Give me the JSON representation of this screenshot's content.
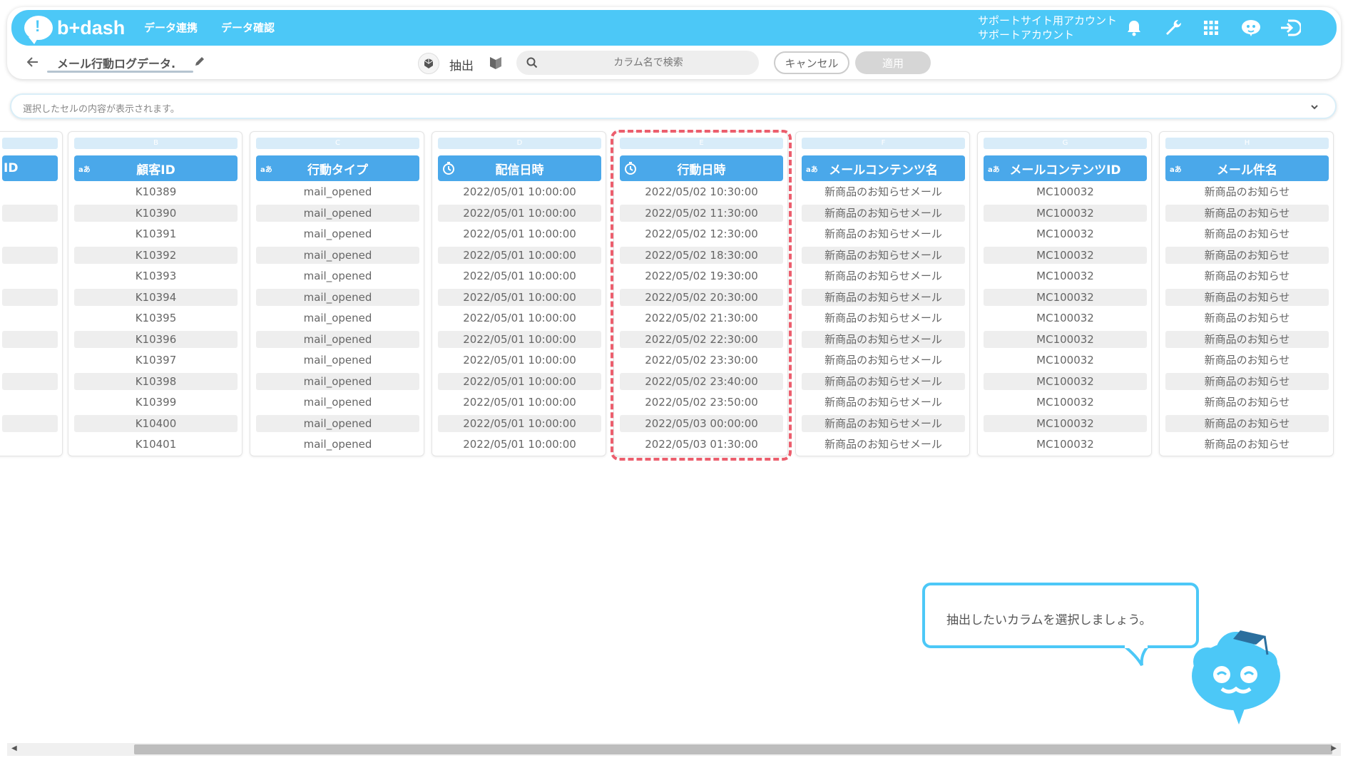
{
  "header": {
    "logo_text": "b+dash",
    "nav": [
      "データ連携",
      "データ確認"
    ],
    "account_line1": "サポートサイト用アカウント",
    "account_line2": "サポートアカウント",
    "icons": [
      "bell-icon",
      "wrench-icon",
      "grid-icon",
      "mascot-icon",
      "logout-icon"
    ]
  },
  "toolbar": {
    "back_icon": "arrow-left-icon",
    "title": "メール行動ログデータ.",
    "extract_label": "抽出",
    "search_placeholder": "カラム名で検索",
    "cancel_label": "キャンセル",
    "apply_label": "適用"
  },
  "cellbar": {
    "placeholder": "選択したセルの内容が表示されます。"
  },
  "columns": [
    {
      "letter": "",
      "type_tag": "",
      "header": "ID",
      "rows": [
        "",
        "",
        "",
        "",
        "",
        "",
        "",
        "",
        "",
        "",
        "",
        "",
        ""
      ]
    },
    {
      "letter": "B",
      "type_tag": "aあ",
      "header": "顧客ID",
      "rows": [
        "K10389",
        "K10390",
        "K10391",
        "K10392",
        "K10393",
        "K10394",
        "K10395",
        "K10396",
        "K10397",
        "K10398",
        "K10399",
        "K10400",
        "K10401"
      ]
    },
    {
      "letter": "C",
      "type_tag": "aあ",
      "header": "行動タイプ",
      "rows": [
        "mail_opened",
        "mail_opened",
        "mail_opened",
        "mail_opened",
        "mail_opened",
        "mail_opened",
        "mail_opened",
        "mail_opened",
        "mail_opened",
        "mail_opened",
        "mail_opened",
        "mail_opened",
        "mail_opened"
      ]
    },
    {
      "letter": "D",
      "type_tag": "clock",
      "header": "配信日時",
      "rows": [
        "2022/05/01 10:00:00",
        "2022/05/01 10:00:00",
        "2022/05/01 10:00:00",
        "2022/05/01 10:00:00",
        "2022/05/01 10:00:00",
        "2022/05/01 10:00:00",
        "2022/05/01 10:00:00",
        "2022/05/01 10:00:00",
        "2022/05/01 10:00:00",
        "2022/05/01 10:00:00",
        "2022/05/01 10:00:00",
        "2022/05/01 10:00:00",
        "2022/05/01 10:00:00"
      ]
    },
    {
      "letter": "E",
      "type_tag": "clock",
      "header": "行動日時",
      "rows": [
        "2022/05/02 10:30:00",
        "2022/05/02 11:30:00",
        "2022/05/02 12:30:00",
        "2022/05/02 18:30:00",
        "2022/05/02 19:30:00",
        "2022/05/02 20:30:00",
        "2022/05/02 21:30:00",
        "2022/05/02 22:30:00",
        "2022/05/02 23:30:00",
        "2022/05/02 23:40:00",
        "2022/05/02 23:50:00",
        "2022/05/03 00:00:00",
        "2022/05/03 01:30:00"
      ]
    },
    {
      "letter": "F",
      "type_tag": "aあ",
      "header": "メールコンテンツ名",
      "rows": [
        "新商品のお知らせメール",
        "新商品のお知らせメール",
        "新商品のお知らせメール",
        "新商品のお知らせメール",
        "新商品のお知らせメール",
        "新商品のお知らせメール",
        "新商品のお知らせメール",
        "新商品のお知らせメール",
        "新商品のお知らせメール",
        "新商品のお知らせメール",
        "新商品のお知らせメール",
        "新商品のお知らせメール",
        "新商品のお知らせメール"
      ]
    },
    {
      "letter": "G",
      "type_tag": "aあ",
      "header": "メールコンテンツID",
      "rows": [
        "MC100032",
        "MC100032",
        "MC100032",
        "MC100032",
        "MC100032",
        "MC100032",
        "MC100032",
        "MC100032",
        "MC100032",
        "MC100032",
        "MC100032",
        "MC100032",
        "MC100032"
      ]
    },
    {
      "letter": "H",
      "type_tag": "aあ",
      "header": "メール件名",
      "rows": [
        "新商品のお知らせ",
        "新商品のお知らせ",
        "新商品のお知らせ",
        "新商品のお知らせ",
        "新商品のお知らせ",
        "新商品のお知らせ",
        "新商品のお知らせ",
        "新商品のお知らせ",
        "新商品のお知らせ",
        "新商品のお知らせ",
        "新商品のお知らせ",
        "新商品のお知らせ",
        "新商品のお知らせ"
      ]
    }
  ],
  "selected_column": "E",
  "tooltip": {
    "text": "抽出したいカラムを選択しましょう。"
  },
  "colors": {
    "brand": "#4cc8f7",
    "header_blue": "#4aa8ea",
    "highlight": "#ec5e6d"
  }
}
